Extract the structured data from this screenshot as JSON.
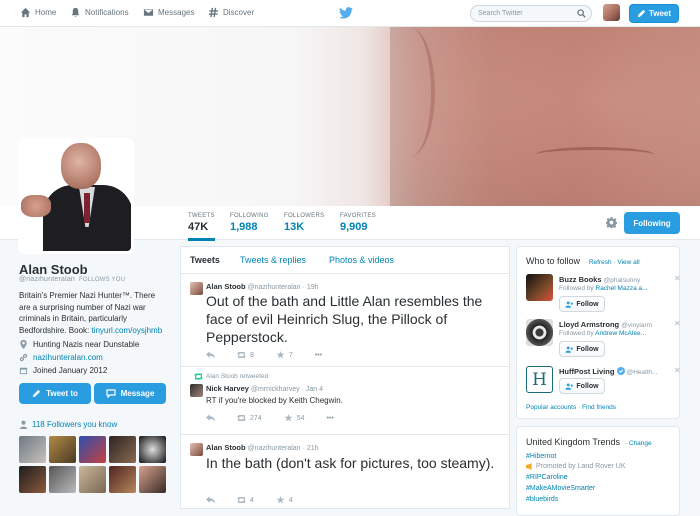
{
  "nav": {
    "home": "Home",
    "notifications": "Notifications",
    "messages": "Messages",
    "discover": "Discover",
    "search_placeholder": "Search Twitter",
    "tweet_button": "Tweet"
  },
  "stats": [
    {
      "label": "TWEETS",
      "value": "47K"
    },
    {
      "label": "FOLLOWING",
      "value": "1,988"
    },
    {
      "label": "FOLLOWERS",
      "value": "13K"
    },
    {
      "label": "FAVORITES",
      "value": "9,909"
    }
  ],
  "following_button": "Following",
  "profile": {
    "name": "Alan Stoob",
    "handle": "@nazihunteralan",
    "follows_you": "FOLLOWS YOU",
    "bio_line1": "Britain's Premier Nazi Hunter™. There",
    "bio_line2": "are a surprising number of Nazi war",
    "bio_line3": "criminals in Britain, particularly",
    "bio_line4_prefix": "Bedfordshire. Book: ",
    "bio_link": "tinyurl.com/oysjhmb",
    "location": "Hunting Nazis near Dunstable",
    "website": "nazihunteralan.com",
    "joined": "Joined January 2012",
    "tweet_to": "Tweet to",
    "message": "Message",
    "followers_you_know": "118 Followers you know"
  },
  "timeline": {
    "tabs": [
      "Tweets",
      "Tweets & replies",
      "Photos & videos"
    ],
    "tweets": [
      {
        "name": "Alan Stoob",
        "handle": "@nazihunteralan",
        "time": "19h",
        "text": "Out of the bath and Little Alan resembles the face of evil Heinrich Slug, the Pillock of Pepperstock.",
        "retweets": "8",
        "favorites": "7"
      },
      {
        "retweeted_by": "Alan Stoob retweeted",
        "name": "Nick Harvey",
        "handle": "@mrnickharvey",
        "time": "Jan 4",
        "text": "RT if you're blocked by Keith Chegwin.",
        "retweets": "274",
        "favorites": "54"
      },
      {
        "name": "Alan Stoob",
        "handle": "@nazihunteralan",
        "time": "21h",
        "text": "In the bath (don't ask for pictures, too steamy).",
        "retweets": "4",
        "favorites": "4"
      }
    ]
  },
  "who_to_follow": {
    "title": "Who to follow",
    "refresh": "Refresh",
    "view_all": "View all",
    "follow_label": "Follow",
    "items": [
      {
        "name": "Buzz Books",
        "handle": "@phatsunny",
        "followed_by_prefix": "Followed by ",
        "followed_by": "Rachel Mazza a..."
      },
      {
        "name": "Lloyd Armstrong",
        "handle": "@vinylarm",
        "followed_by_prefix": "Followed by ",
        "followed_by": "Andrew McAlee..."
      },
      {
        "name": "HuffPost Living",
        "handle": "@Health...",
        "followed_by_prefix": "",
        "followed_by": ""
      }
    ],
    "footer_popular": "Popular accounts",
    "footer_sep": " · ",
    "footer_find": "Find friends"
  },
  "trends": {
    "title": "United Kingdom Trends",
    "change": "Change",
    "items": [
      "#Hibernot",
      "Promoted by Land Rover UK",
      "#RIPCaroline",
      "#MakeAMovieSmarter",
      "#bluebirds"
    ]
  },
  "colors": {
    "accent": "#2a9de0",
    "link": "#0084b4"
  }
}
